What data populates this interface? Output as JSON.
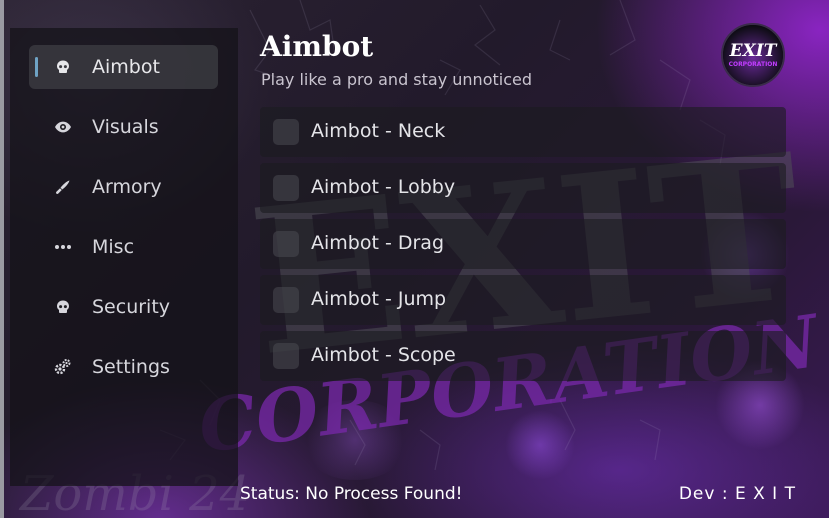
{
  "sidebar": {
    "items": [
      {
        "label": "Aimbot",
        "icon": "skull-icon",
        "active": true
      },
      {
        "label": "Visuals",
        "icon": "eye-icon",
        "active": false
      },
      {
        "label": "Armory",
        "icon": "knife-icon",
        "active": false
      },
      {
        "label": "Misc",
        "icon": "ellipsis-icon",
        "active": false
      },
      {
        "label": "Security",
        "icon": "skull-icon",
        "active": false
      },
      {
        "label": "Settings",
        "icon": "gears-icon",
        "active": false
      }
    ]
  },
  "header": {
    "title": "Aimbot",
    "subtitle": "Play like a pro and stay unnoticed"
  },
  "logo": {
    "text": "EXIT",
    "subtext": "CORPORATION"
  },
  "options": [
    {
      "label": "Aimbot - Neck",
      "checked": false
    },
    {
      "label": "Aimbot - Lobby",
      "checked": false
    },
    {
      "label": "Aimbot - Drag",
      "checked": false
    },
    {
      "label": "Aimbot - Jump",
      "checked": false
    },
    {
      "label": "Aimbot - Scope",
      "checked": false
    }
  ],
  "background": {
    "title_text": "EXIT",
    "sub_text": "CORPORATION",
    "watermark": "Zombi 24"
  },
  "footer": {
    "status": "Status: No Process Found!",
    "dev": "Dev : E X I T"
  },
  "colors": {
    "accent": "#6fa3c4",
    "purple": "#7a2bb0",
    "text": "#e7e7ea"
  }
}
